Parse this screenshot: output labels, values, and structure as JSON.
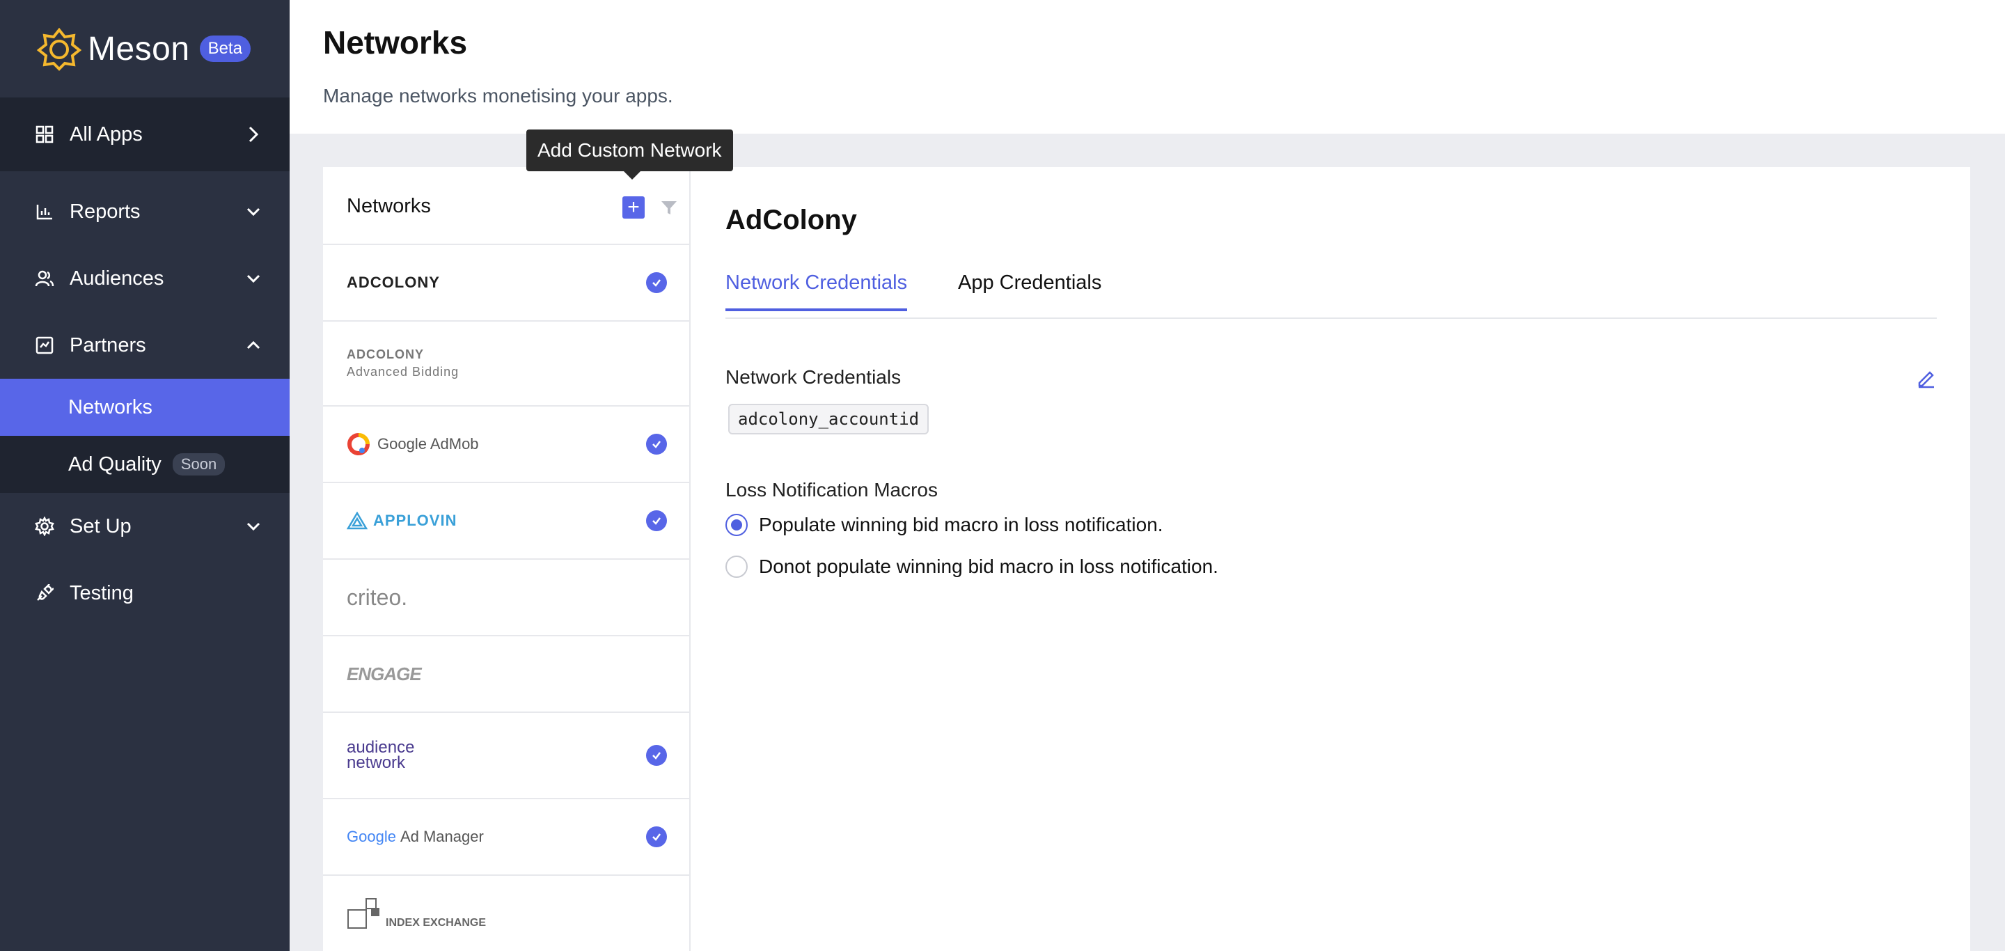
{
  "brand": {
    "name": "Meson",
    "badge": "Beta"
  },
  "sidebar": {
    "all_apps": "All Apps",
    "items": [
      {
        "label": "Reports"
      },
      {
        "label": "Audiences"
      },
      {
        "label": "Partners"
      },
      {
        "label": "Set Up"
      },
      {
        "label": "Testing"
      }
    ],
    "partners_sub": [
      {
        "label": "Networks"
      },
      {
        "label": "Ad Quality",
        "badge": "Soon"
      }
    ]
  },
  "header": {
    "title": "Networks",
    "subtitle": "Manage networks monetising your apps."
  },
  "tooltip": "Add Custom Network",
  "network_list": {
    "title": "Networks",
    "add_symbol": "+",
    "rows": [
      {
        "logo": "ADCOLONY",
        "checked": true
      },
      {
        "logo": "ADCOLONY",
        "sub": "Advanced Bidding",
        "checked": false
      },
      {
        "logo": "Google AdMob",
        "checked": true
      },
      {
        "logo": "APPLOVIN",
        "checked": true
      },
      {
        "logo": "criteo.",
        "checked": false
      },
      {
        "logo": "ENGAGE",
        "checked": false
      },
      {
        "logo": "audience network",
        "checked": true
      },
      {
        "logo_google": "Google",
        "logo": "Ad Manager",
        "checked": true
      },
      {
        "logo": "INDEX EXCHANGE",
        "checked": false
      }
    ]
  },
  "detail": {
    "title": "AdColony",
    "tabs": [
      {
        "label": "Network Credentials",
        "active": true
      },
      {
        "label": "App Credentials",
        "active": false
      }
    ],
    "credentials_label": "Network Credentials",
    "credential_key": "adcolony_accountid",
    "loss_label": "Loss Notification Macros",
    "options": [
      {
        "label": "Populate winning bid macro in loss notification.",
        "selected": true
      },
      {
        "label": "Donot populate winning bid macro in loss notification.",
        "selected": false
      }
    ]
  },
  "colors": {
    "accent": "#5866e8",
    "sidebar_bg": "#2b3141",
    "sidebar_dark": "#1f2430"
  }
}
